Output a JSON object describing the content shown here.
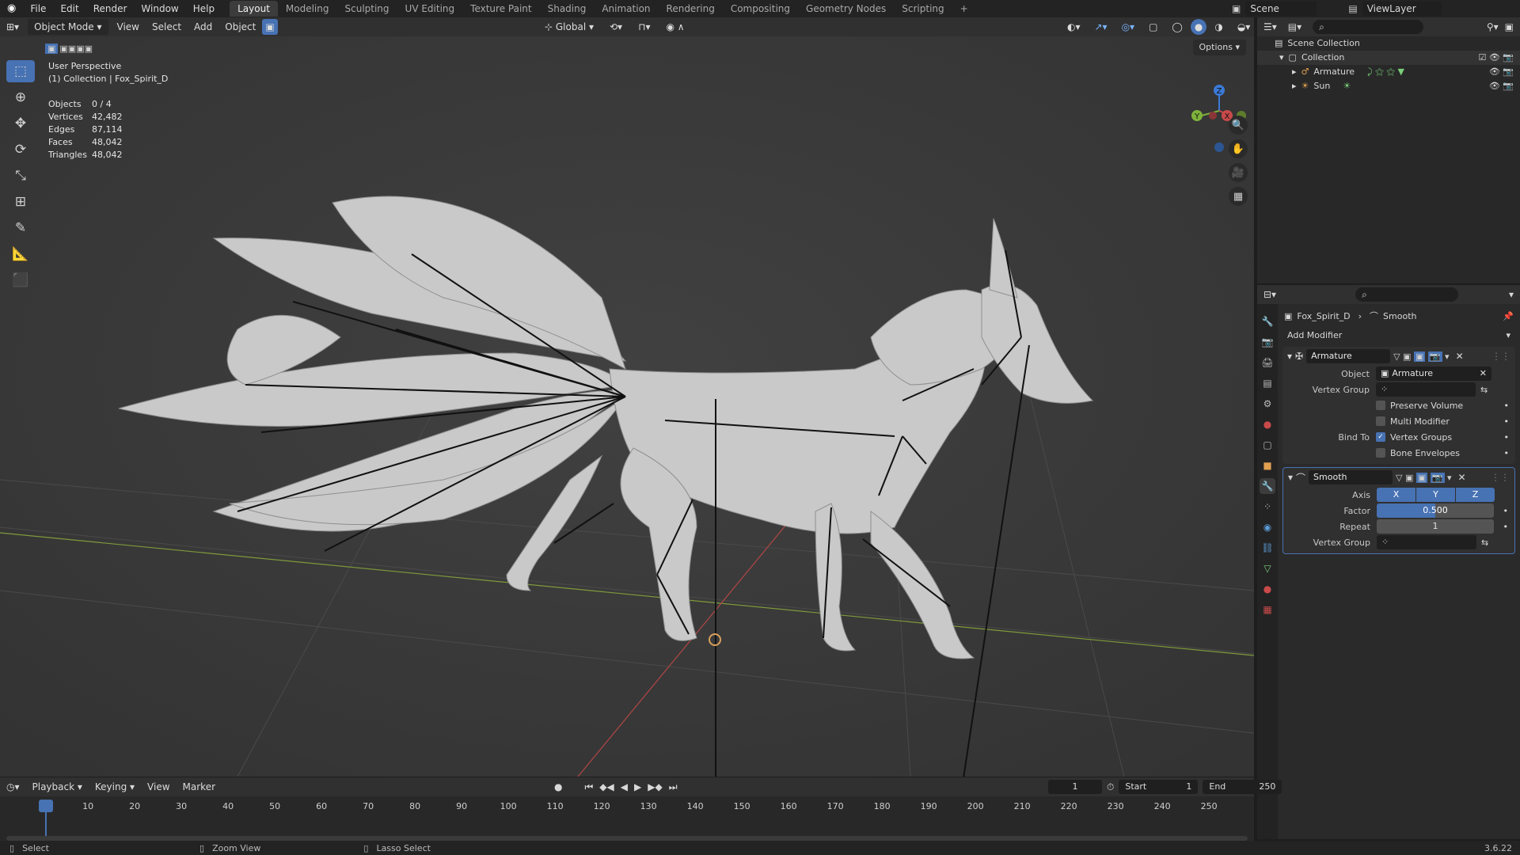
{
  "topbar": {
    "menus": [
      "File",
      "Edit",
      "Render",
      "Window",
      "Help"
    ],
    "workspaces": [
      "Layout",
      "Modeling",
      "Sculpting",
      "UV Editing",
      "Texture Paint",
      "Shading",
      "Animation",
      "Rendering",
      "Compositing",
      "Geometry Nodes",
      "Scripting"
    ],
    "active_workspace": "Layout",
    "add_tab": "+",
    "scene": "Scene",
    "view_layer": "ViewLayer"
  },
  "header3d": {
    "mode": "Object Mode",
    "menus": [
      "View",
      "Select",
      "Add",
      "Object"
    ],
    "orientation": "Global",
    "options": "Options"
  },
  "viewport": {
    "view_name": "User Perspective",
    "collection": "(1) Collection | Fox_Spirit_D",
    "stats": [
      {
        "k": "Objects",
        "v": "0 / 4"
      },
      {
        "k": "Vertices",
        "v": "42,482"
      },
      {
        "k": "Edges",
        "v": "87,114"
      },
      {
        "k": "Faces",
        "v": "48,042"
      },
      {
        "k": "Triangles",
        "v": "48,042"
      }
    ],
    "gizmo": {
      "x": "X",
      "y": "Y",
      "z": "Z"
    }
  },
  "outliner": {
    "rows": [
      {
        "label": "Scene Collection"
      },
      {
        "label": "Collection"
      },
      {
        "label": "Armature"
      },
      {
        "label": "Sun"
      }
    ]
  },
  "properties": {
    "breadcrumb_object": "Fox_Spirit_D",
    "breadcrumb_modifier": "Smooth",
    "add_modifier": "Add Modifier",
    "armature_mod": {
      "name": "Armature",
      "object_label": "Object",
      "object_value": "Armature",
      "vgroup_label": "Vertex Group",
      "preserve_volume": "Preserve Volume",
      "multi_modifier": "Multi Modifier",
      "bind_to_label": "Bind To",
      "vertex_groups": "Vertex Groups",
      "bone_envelopes": "Bone Envelopes"
    },
    "smooth_mod": {
      "name": "Smooth",
      "axis_label": "Axis",
      "axes": [
        "X",
        "Y",
        "Z"
      ],
      "factor_label": "Factor",
      "factor_value": "0.500",
      "repeat_label": "Repeat",
      "repeat_value": "1",
      "vgroup_label": "Vertex Group"
    }
  },
  "timeline": {
    "menus": [
      "Playback",
      "Keying",
      "View",
      "Marker"
    ],
    "current_frame": "1",
    "start_label": "Start",
    "start": "1",
    "end_label": "End",
    "end": "250",
    "ticks": [
      "1",
      "10",
      "20",
      "30",
      "40",
      "50",
      "60",
      "70",
      "80",
      "90",
      "100",
      "110",
      "120",
      "130",
      "140",
      "150",
      "160",
      "170",
      "180",
      "190",
      "200",
      "210",
      "220",
      "230",
      "240",
      "250"
    ]
  },
  "statusbar": {
    "select": "Select",
    "zoom": "Zoom View",
    "lasso": "Lasso Select",
    "version": "3.6.22"
  }
}
